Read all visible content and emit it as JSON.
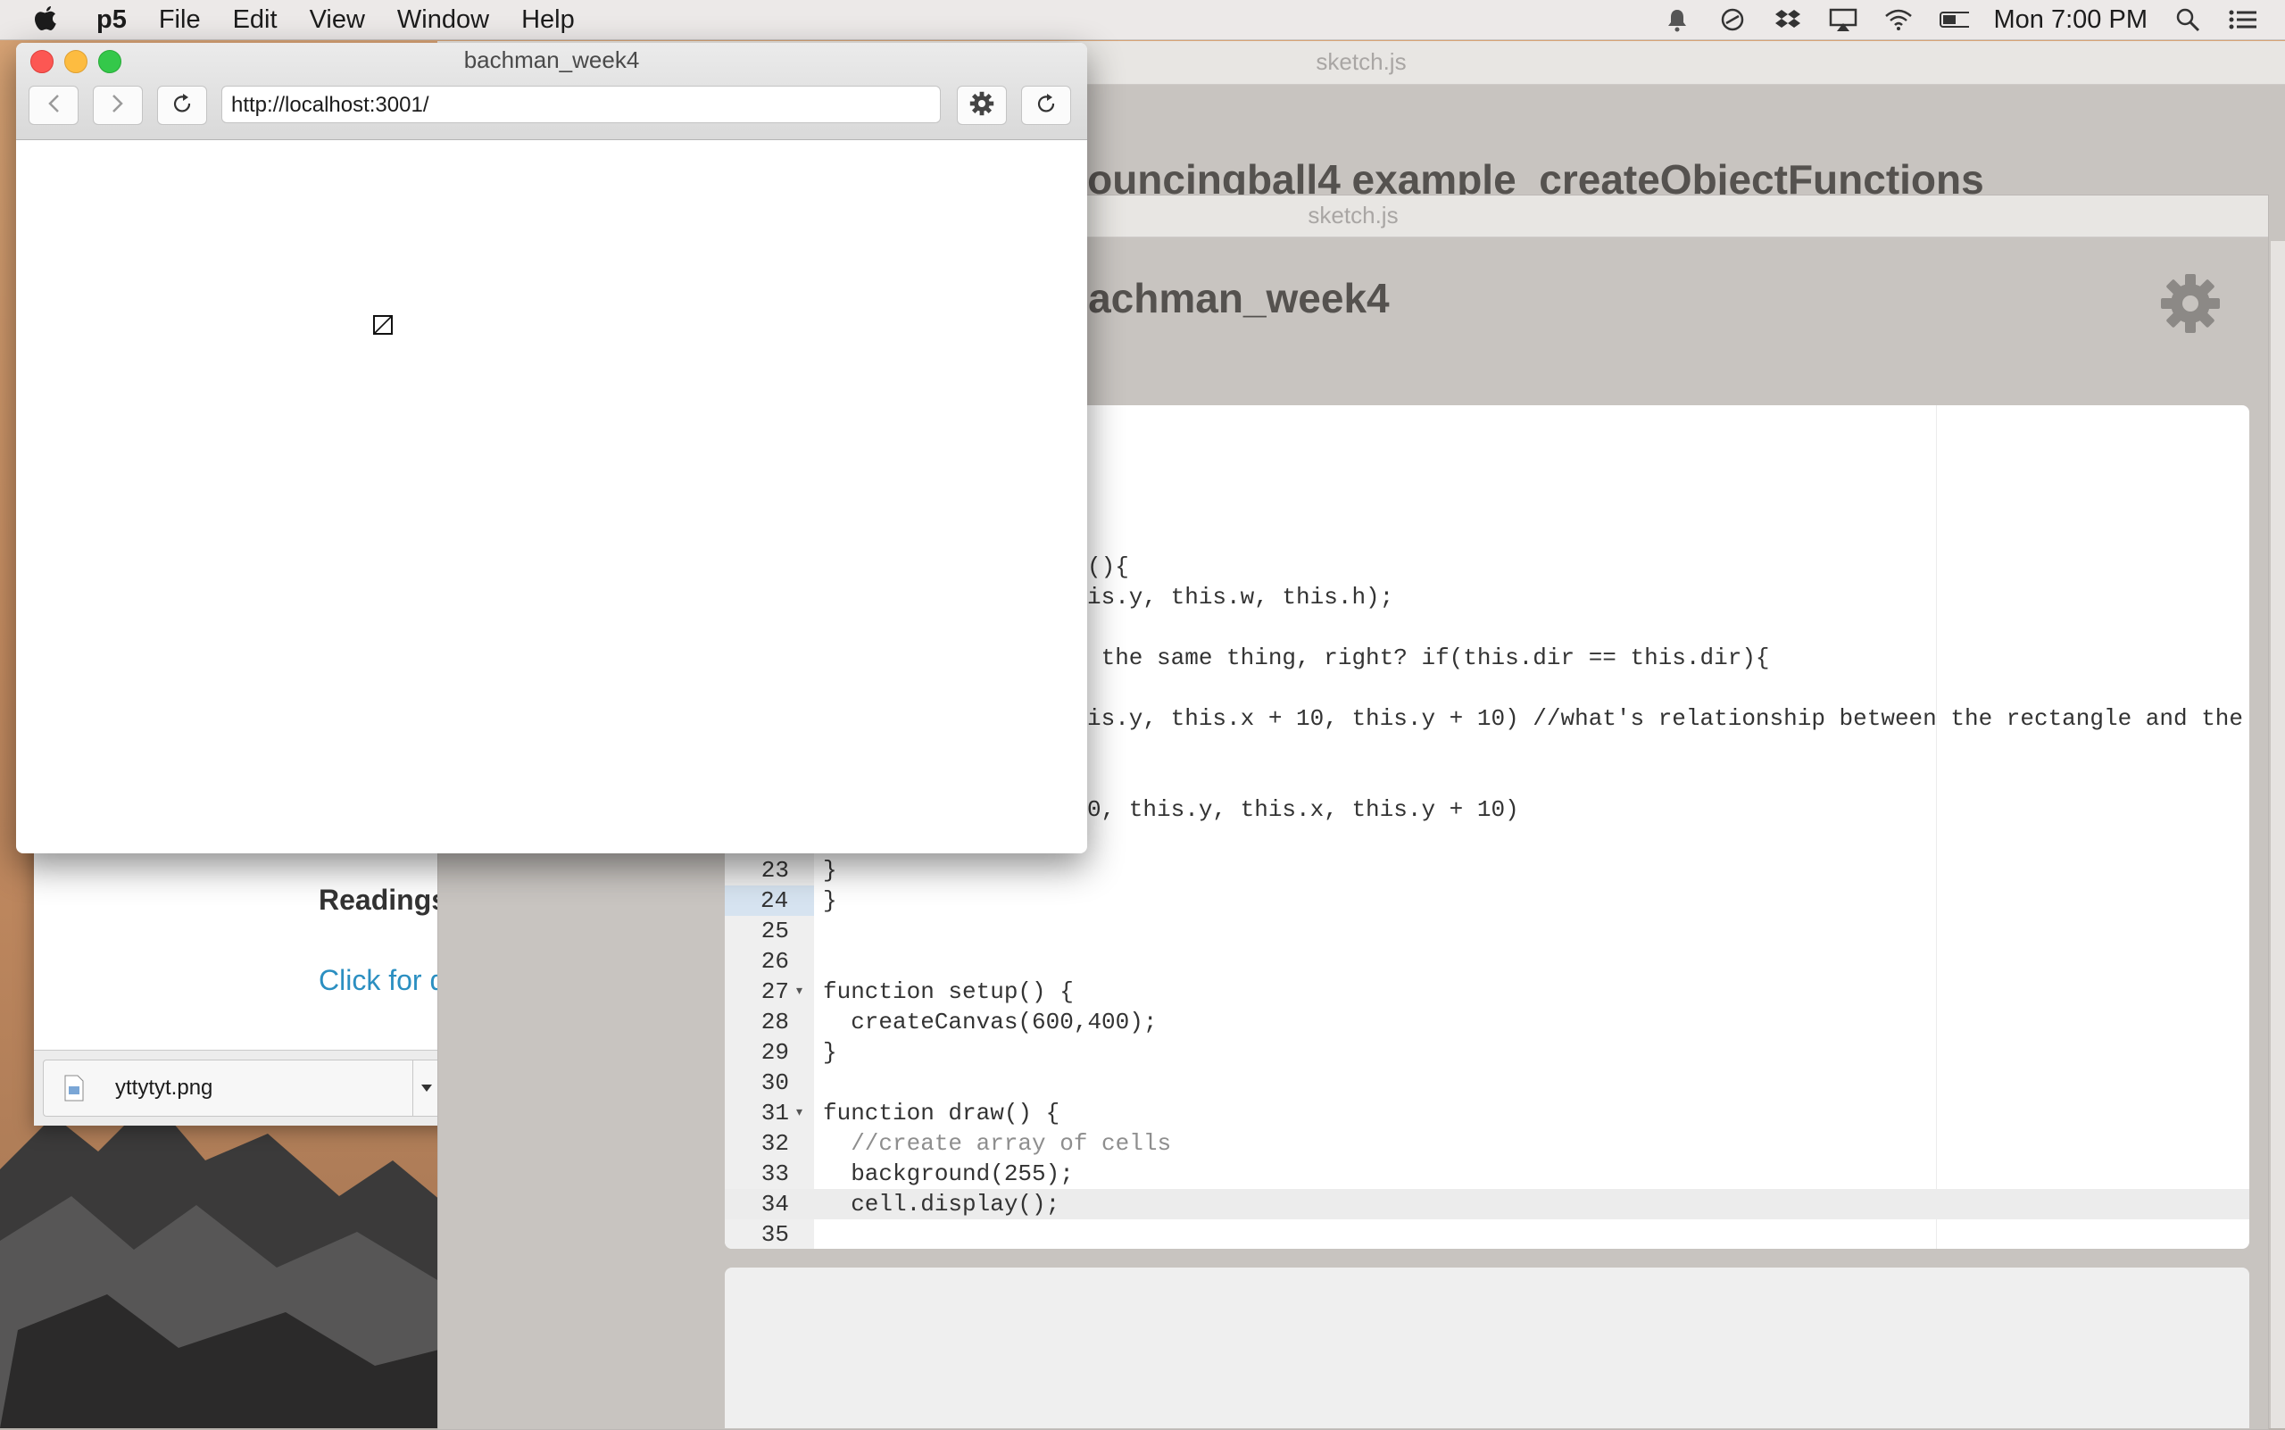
{
  "menubar": {
    "apple_icon": "apple-icon",
    "app_name": "p5",
    "items": [
      "File",
      "Edit",
      "View",
      "Window",
      "Help"
    ],
    "clock": "Mon 7:00 PM",
    "status_icons": [
      "notification-icon",
      "sync-icon",
      "dropbox-icon",
      "airplay-icon",
      "wifi-icon",
      "battery-icon",
      "spotlight-icon",
      "notification-center-icon"
    ]
  },
  "p5_back": {
    "title": "sketch.js",
    "sketch_name": "bouncingball4 example_createObjectFunctions"
  },
  "p5_front": {
    "title": "sketch.js",
    "sketch_name": "bachman_week4",
    "settings_icon": "gear-icon"
  },
  "editor": {
    "visible_fragments": [
      "(){",
      "is.y, this.w, this.h);",
      " the same thing, right? if(this.dir == this.dir){",
      "is.y, this.x + 10, this.y + 10) //what's relationship between the rectangle and the",
      "0, this.y, this.x, this.y + 10)"
    ],
    "lines": [
      {
        "n": "23",
        "code": "}"
      },
      {
        "n": "24",
        "code": "}"
      },
      {
        "n": "25",
        "code": ""
      },
      {
        "n": "26",
        "code": ""
      },
      {
        "n": "27",
        "code": "function setup() {"
      },
      {
        "n": "28",
        "code": "  createCanvas(600,400);"
      },
      {
        "n": "29",
        "code": "}"
      },
      {
        "n": "30",
        "code": ""
      },
      {
        "n": "31",
        "code": "function draw() {"
      },
      {
        "n": "32",
        "code": "  //create array of cells"
      },
      {
        "n": "33",
        "code": "  background(255);"
      },
      {
        "n": "34",
        "code": "  cell.display();"
      },
      {
        "n": "35",
        "code": ""
      }
    ]
  },
  "browser": {
    "title": "bachman_week4",
    "url": "http://localhost:3001/",
    "back_icon": "back-arrow-icon",
    "forward_icon": "forward-arrow-icon",
    "reload_icon": "reload-icon",
    "settings_icon": "gear-icon",
    "refresh_icon": "refresh-icon"
  },
  "bg_page": {
    "heading": "Readings",
    "link": "Click for d",
    "download_file": "yttytyt.png"
  }
}
